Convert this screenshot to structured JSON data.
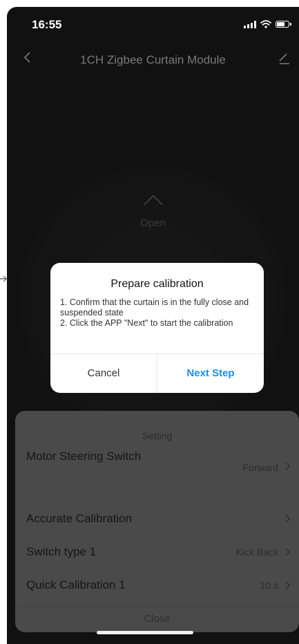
{
  "status_bar": {
    "time": "16:55",
    "signal_icon": "signal-bars-icon",
    "wifi_icon": "wifi-icon",
    "battery_icon": "battery-icon",
    "battery_level": 0.8
  },
  "header": {
    "title": "1CH Zigbee Curtain Module",
    "back_icon": "chevron-left-icon",
    "edit_icon": "pencil-icon"
  },
  "control": {
    "open_label": "Open",
    "open_icon": "chevron-up-icon"
  },
  "settings_sheet": {
    "title": "Setting",
    "rows": [
      {
        "label": "Motor Steering Switch",
        "value": "Forward"
      },
      {
        "label": "Accurate Calibration",
        "value": ""
      },
      {
        "label": "Switch type 1",
        "value": "Kick Back"
      },
      {
        "label": "Quick Calibration 1",
        "value": "10 s"
      }
    ],
    "close_label": "Close"
  },
  "dialog": {
    "title": "Prepare calibration",
    "message_line1": "1. Confirm that the curtain is in the fully close and suspended state",
    "message_line2": "2. Click the APP \"Next\" to start the calibration",
    "cancel_label": "Cancel",
    "next_label": "Next Step"
  },
  "colors": {
    "accent": "#1a8fe8",
    "background": "#111111",
    "dialog_background": "#ffffff"
  }
}
